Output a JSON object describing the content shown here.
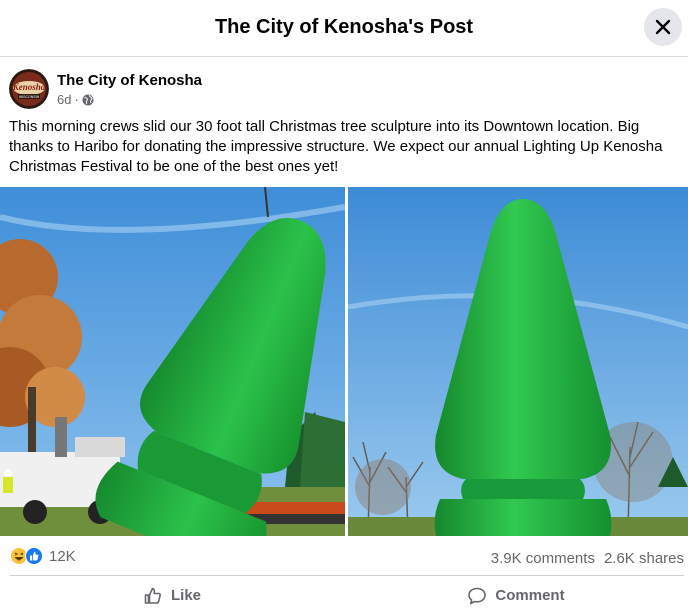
{
  "modal": {
    "title": "The City of Kenosha's Post"
  },
  "post": {
    "author": "The City of Kenosha",
    "time": "6d",
    "separator": "·",
    "visibility_icon": "globe-icon",
    "avatar_text": "Kenosha",
    "avatar_subtext": "WISCONSIN",
    "text": "This morning crews slid our 30 foot tall Christmas tree sculpture into its Downtown location.  Big thanks to Haribo for donating the impressive structure.  We expect our annual Lighting Up Kenosha Christmas Festival to be one of the best ones yet!",
    "photos": [
      {
        "alt_icon": "photo-crane-lifting-green-tree-sculpture"
      },
      {
        "alt_icon": "photo-green-tree-sculpture-in-park"
      }
    ]
  },
  "stats": {
    "reaction_icons": [
      "haha-icon",
      "like-icon"
    ],
    "reaction_count": "12K",
    "comments": "3.9K comments",
    "shares": "2.6K shares"
  },
  "actions": {
    "like_label": "Like",
    "comment_label": "Comment"
  },
  "colors": {
    "sculpture_green": "#1fa83a",
    "sky_blue": "#4a95d8",
    "facebook_blue": "#1877f2",
    "text_secondary": "#65676b"
  }
}
